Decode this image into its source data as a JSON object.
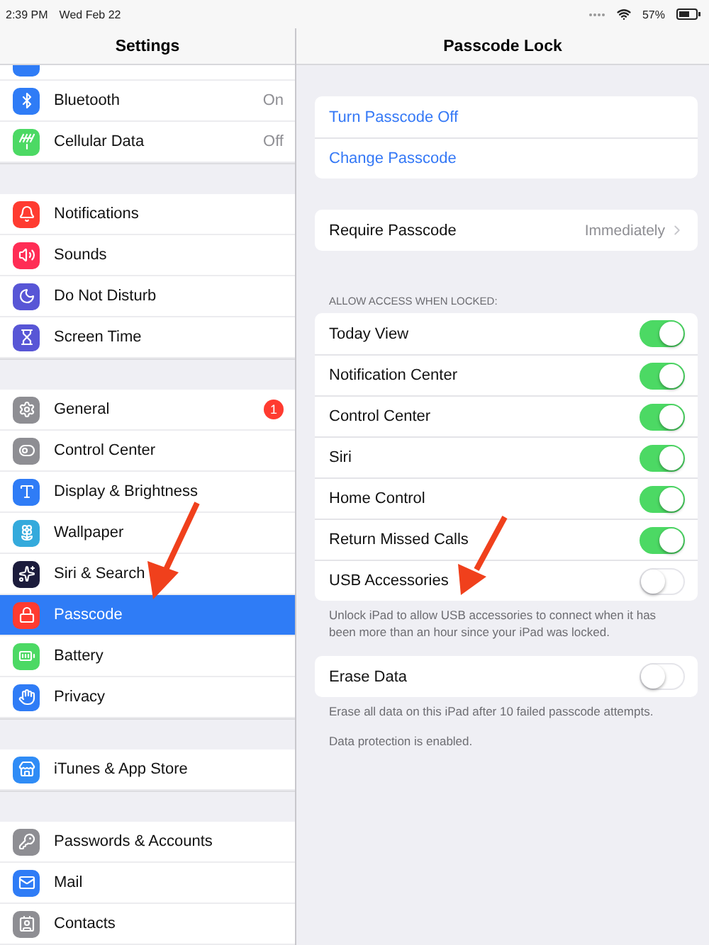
{
  "status_bar": {
    "time": "2:39 PM",
    "date": "Wed Feb 22",
    "battery": "57%"
  },
  "sidebar": {
    "title": "Settings",
    "groups": [
      {
        "items": [
          {
            "label": "Bluetooth",
            "value": "On",
            "selected": false
          },
          {
            "label": "Cellular Data",
            "value": "Off",
            "selected": false
          }
        ]
      },
      {
        "items": [
          {
            "label": "Notifications",
            "selected": false
          },
          {
            "label": "Sounds",
            "selected": false
          },
          {
            "label": "Do Not Disturb",
            "selected": false
          },
          {
            "label": "Screen Time",
            "selected": false
          }
        ]
      },
      {
        "items": [
          {
            "label": "General",
            "badge": "1",
            "selected": false
          },
          {
            "label": "Control Center",
            "selected": false
          },
          {
            "label": "Display & Brightness",
            "selected": false
          },
          {
            "label": "Wallpaper",
            "selected": false
          },
          {
            "label": "Siri & Search",
            "selected": false
          },
          {
            "label": "Passcode",
            "selected": true
          },
          {
            "label": "Battery",
            "selected": false
          },
          {
            "label": "Privacy",
            "selected": false
          }
        ]
      },
      {
        "items": [
          {
            "label": "iTunes & App Store",
            "selected": false
          }
        ]
      },
      {
        "items": [
          {
            "label": "Passwords & Accounts",
            "selected": false
          },
          {
            "label": "Mail",
            "selected": false
          },
          {
            "label": "Contacts",
            "selected": false
          }
        ]
      }
    ]
  },
  "detail": {
    "title": "Passcode Lock",
    "sections": [
      {
        "rows": [
          {
            "kind": "link",
            "label": "Turn Passcode Off"
          },
          {
            "kind": "link",
            "label": "Change Passcode"
          }
        ]
      },
      {
        "rows": [
          {
            "kind": "value",
            "label": "Require Passcode",
            "value": "Immediately"
          }
        ]
      },
      {
        "header": "ALLOW ACCESS WHEN LOCKED:",
        "rows": [
          {
            "kind": "toggle",
            "label": "Today View",
            "on": true
          },
          {
            "kind": "toggle",
            "label": "Notification Center",
            "on": true
          },
          {
            "kind": "toggle",
            "label": "Control Center",
            "on": true
          },
          {
            "kind": "toggle",
            "label": "Siri",
            "on": true
          },
          {
            "kind": "toggle",
            "label": "Home Control",
            "on": true
          },
          {
            "kind": "toggle",
            "label": "Return Missed Calls",
            "on": true
          },
          {
            "kind": "toggle",
            "label": "USB Accessories",
            "on": false
          }
        ],
        "footer": [
          "Unlock iPad to allow USB accessories to connect when it has been more than an hour since your iPad was locked."
        ]
      },
      {
        "rows": [
          {
            "kind": "toggle",
            "label": "Erase Data",
            "on": false
          }
        ],
        "footer": [
          "Erase all data on this iPad after 10 failed passcode attempts.",
          "Data protection is enabled."
        ]
      }
    ]
  }
}
